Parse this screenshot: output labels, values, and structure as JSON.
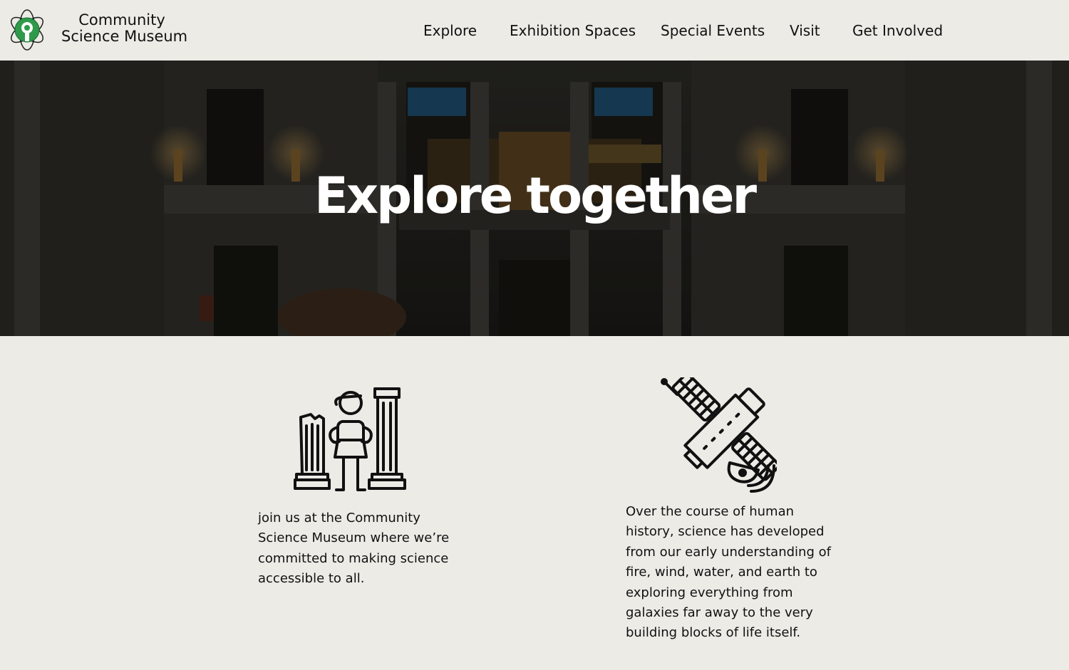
{
  "brand": {
    "name_line1": "Community",
    "name_line2": "Science Museum",
    "logo_icon": "atom-leaf-icon",
    "accent": "#2e9a4a"
  },
  "nav": {
    "items": [
      {
        "label": "Explore"
      },
      {
        "label": "Exhibition Spaces"
      },
      {
        "label": "Special Events"
      },
      {
        "label": "Visit"
      },
      {
        "label": "Get Involved"
      }
    ]
  },
  "hero": {
    "title": "Explore together",
    "image": "museum-interior-photo"
  },
  "features": [
    {
      "icon": "child-with-columns-icon",
      "lines": [
        "join us at the Community",
        "Science Museum where we’re",
        "committed to making science",
        "accessible to all."
      ]
    },
    {
      "icon": "satellite-icon",
      "lines": [
        "Over the course of human",
        "history, science has developed",
        "from our early understanding of",
        "fire, wind, water, and earth to",
        "exploring everything from",
        "galaxies far away to the very",
        "building blocks of life itself."
      ]
    }
  ],
  "colors": {
    "background": "#ecebe6",
    "text": "#111111",
    "hero_overlay": "#1d1c18"
  }
}
